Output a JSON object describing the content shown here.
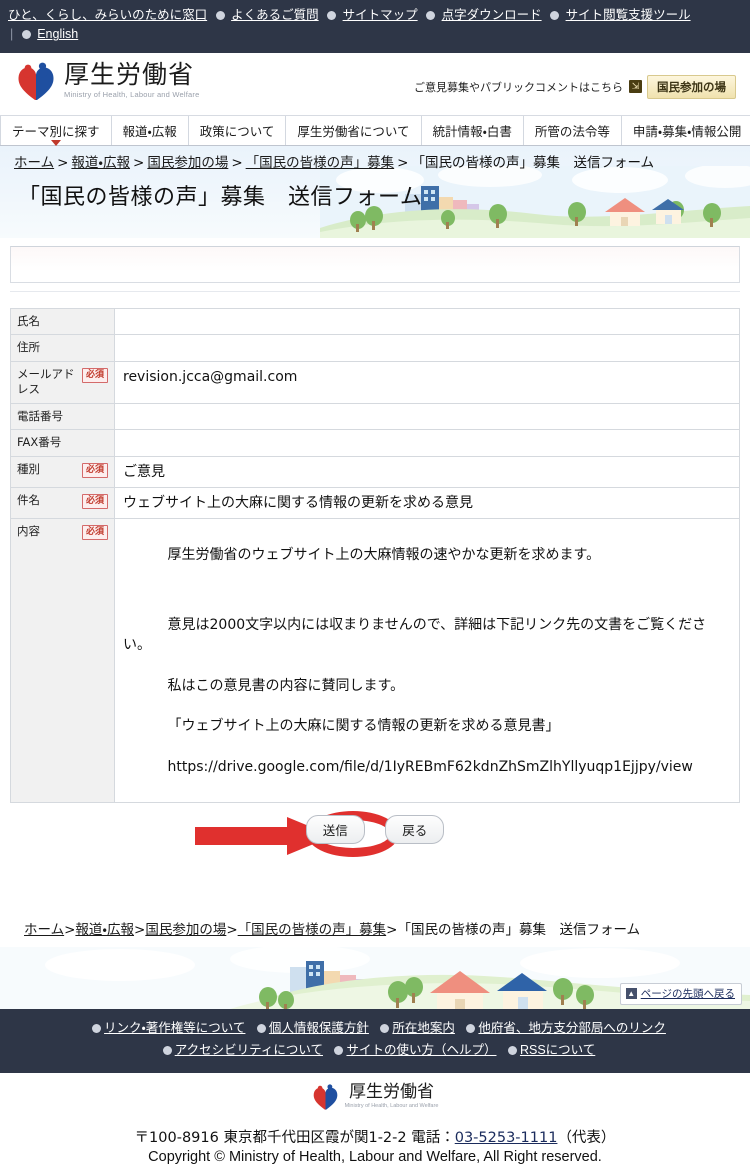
{
  "topbar": {
    "links": [
      "ひと、くらし、みらいのために窓口",
      "よくあるご質問",
      "サイトマップ",
      "点字ダウンロード",
      "サイト閲覧支援ツール"
    ],
    "english_label": "English"
  },
  "header": {
    "logo_jp": "厚生労働省",
    "logo_en": "Ministry of Health, Labour and Welfare",
    "notice_label": "ご意見募集やパブリックコメントはこちら",
    "notice_button": "国民参加の場",
    "notice_icon": "external-link-icon"
  },
  "gnav": {
    "items": [
      {
        "label": "テーマ別に探す",
        "active": true
      },
      {
        "label": "報道・広報",
        "active": false
      },
      {
        "label": "政策について",
        "active": false
      },
      {
        "label": "厚生労働省について",
        "active": false
      },
      {
        "label": "統計情報・白書",
        "active": false
      },
      {
        "label": "所管の法令等",
        "active": false
      },
      {
        "label": "申請・募集・情報公開",
        "active": false
      }
    ]
  },
  "breadcrumb": {
    "items": [
      {
        "label": "ホーム",
        "link": true
      },
      {
        "label": "報道・広報",
        "link": true
      },
      {
        "label": "国民参加の場",
        "link": true
      },
      {
        "label": "「国民の皆様の声」募集",
        "link": true
      },
      {
        "label": "「国民の皆様の声」募集　送信フォーム",
        "link": false
      }
    ],
    "separator": ">"
  },
  "page": {
    "title": "「国民の皆様の声」募集　送信フォーム"
  },
  "form": {
    "required_badge": "必須",
    "rows": [
      {
        "label": "氏名",
        "required": false,
        "value": "",
        "multiline": false
      },
      {
        "label": "住所",
        "required": false,
        "value": "",
        "multiline": false
      },
      {
        "label": "メールアドレス",
        "required": true,
        "value": "revision.jcca@gmail.com",
        "multiline": false
      },
      {
        "label": "電話番号",
        "required": false,
        "value": "",
        "multiline": false
      },
      {
        "label": "FAX番号",
        "required": false,
        "value": "",
        "multiline": false
      },
      {
        "label": "種別",
        "required": true,
        "value": "ご意見",
        "multiline": false
      },
      {
        "label": "件名",
        "required": true,
        "value": "ウェブサイト上の大麻に関する情報の更新を求める意見",
        "multiline": false
      },
      {
        "label": "内容",
        "required": true,
        "multiline": true,
        "value_lines": [
          "厚生労働省のウェブサイト上の大麻情報の速やかな更新を求めます。",
          "",
          "意見は2000文字以内には収まりませんので、詳細は下記リンク先の文書をご覧ください。",
          "私はこの意見書の内容に賛同します。",
          "「ウェブサイト上の大麻に関する情報の更新を求める意見書」",
          "https://drive.google.com/file/d/1IyREBmF62kdnZhSmZlhYllyuqp1Ejjpy/view"
        ]
      }
    ]
  },
  "buttons": {
    "submit": "送信",
    "back": "戻る"
  },
  "annotation": {
    "color": "#e0302e",
    "arrow_name": "red-arrow-annotation",
    "circle_name": "red-circle-annotation"
  },
  "pagetop": {
    "label": "ページの先頭へ戻る",
    "icon": "up-arrow-icon"
  },
  "footer": {
    "links_row1": [
      "リンク・著作権等について",
      "個人情報保護方針",
      "所在地案内",
      "他府省、地方支分部局へのリンク"
    ],
    "links_row2": [
      "アクセシビリティについて",
      "サイトの使い方（ヘルプ）",
      "RSSについて"
    ],
    "logo_jp": "厚生労働省",
    "logo_en": "Ministry of Health, Labour and Welfare",
    "address_pre": "〒100-8916 東京都千代田区霞が関1-2-2 電話：",
    "address_tel": "03-5253-1111",
    "address_post": "（代表）",
    "copyright": "Copyright © Ministry of Health, Labour and Welfare, All Right reserved."
  },
  "colors": {
    "topbar_bg": "#2e3647",
    "accent_red": "#c0392b",
    "annotation_red": "#e0302e",
    "notice_button": "#f0e2ae"
  }
}
